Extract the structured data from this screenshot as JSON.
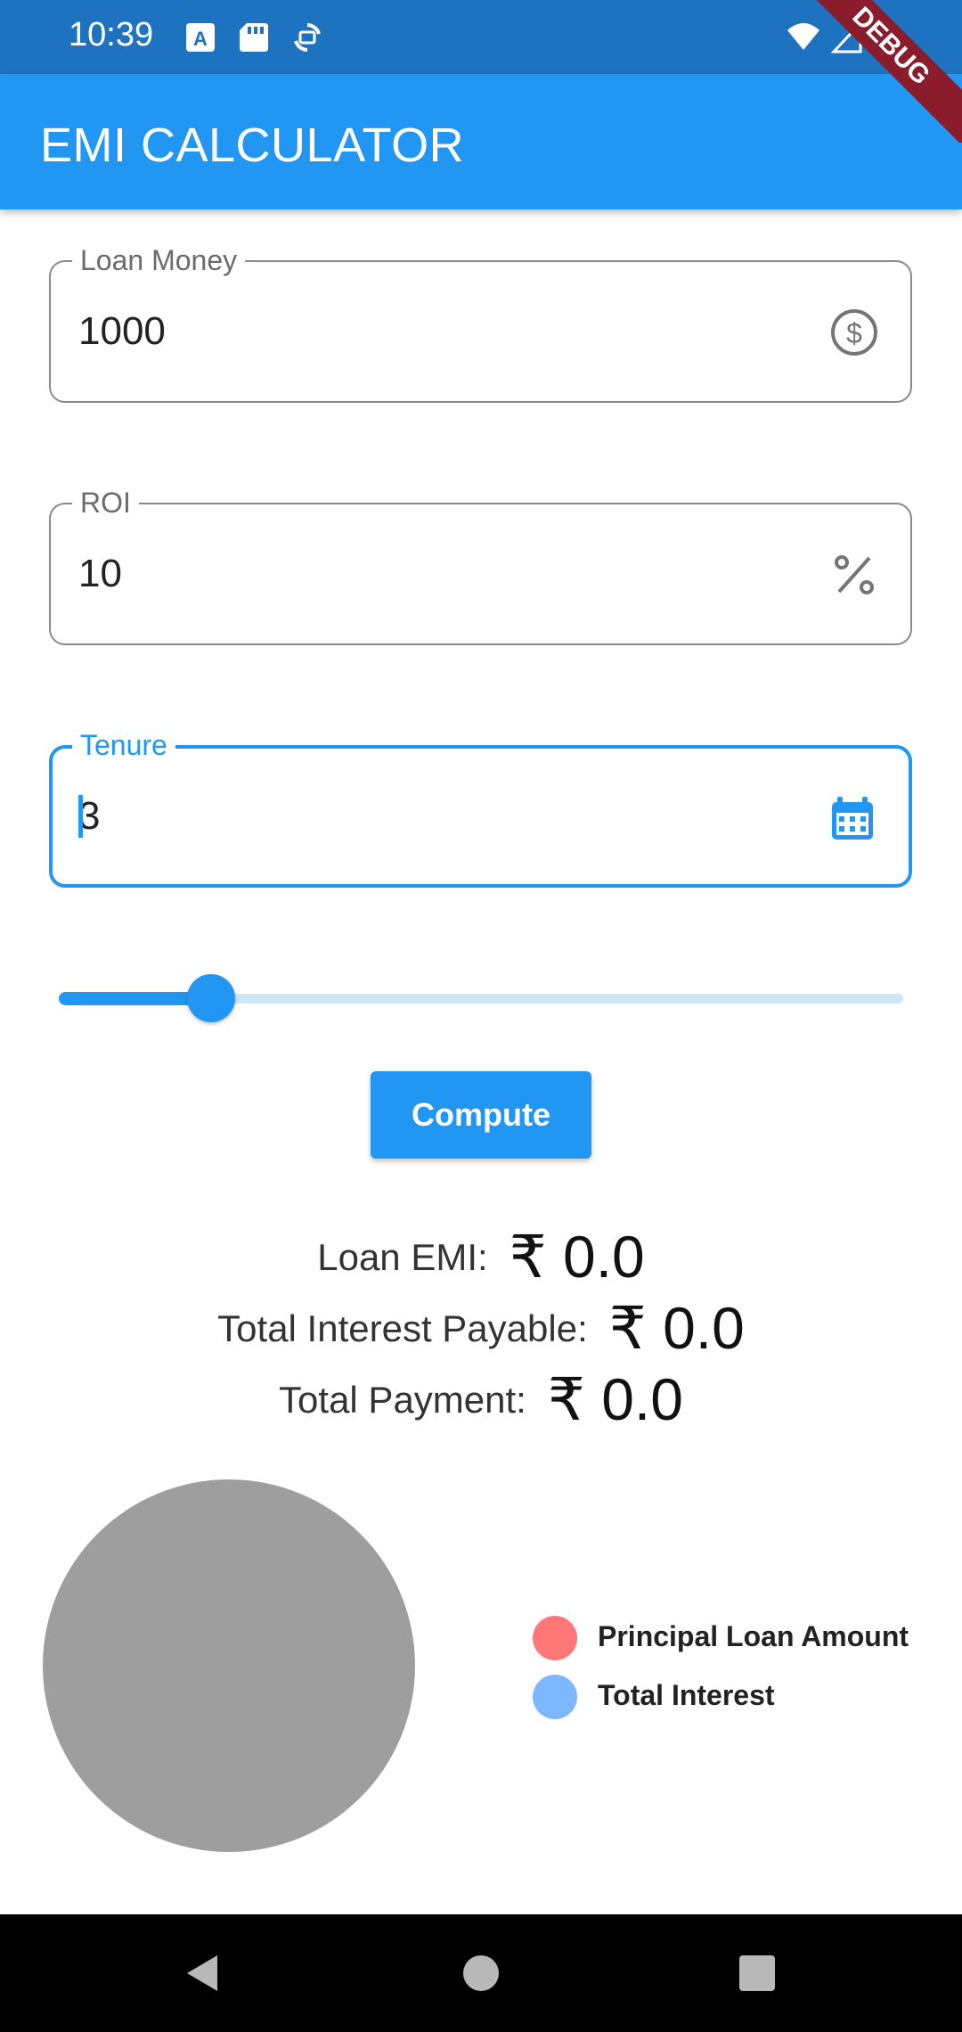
{
  "status_bar": {
    "time": "10:39",
    "left_icons": [
      "keyboard-a-icon",
      "sd-card-icon",
      "sync-icon"
    ],
    "right_icons": [
      "wifi-icon",
      "signal-icon",
      "battery-icon"
    ],
    "debug_banner": "DEBUG"
  },
  "app_bar": {
    "title": "EMI CALCULATOR",
    "color": "#2196f3"
  },
  "form": {
    "loan_money": {
      "label": "Loan Money",
      "value": "1000",
      "icon": "dollar-circle-icon"
    },
    "roi": {
      "label": "ROI",
      "value": "10",
      "icon": "percent-icon"
    },
    "tenure": {
      "label": "Tenure",
      "value": "3",
      "icon": "calendar-icon",
      "focused": true
    }
  },
  "slider": {
    "value_fraction": 0.18
  },
  "compute_button": {
    "label": "Compute"
  },
  "results": {
    "loan_emi": {
      "label": "Loan EMI:",
      "value": "₹ 0.0"
    },
    "total_interest": {
      "label": "Total Interest Payable:",
      "value": "₹ 0.0"
    },
    "total_payment": {
      "label": "Total Payment:",
      "value": "₹ 0.0"
    }
  },
  "chart_data": {
    "type": "pie",
    "empty_color": "#9e9e9e",
    "values": [],
    "legend": [
      {
        "label": "Principal Loan Amount",
        "color": "#ff7777"
      },
      {
        "label": "Total Interest",
        "color": "#7cb8ff"
      }
    ]
  },
  "nav_bar": {
    "buttons": [
      "back-icon",
      "home-icon",
      "recents-icon"
    ]
  }
}
